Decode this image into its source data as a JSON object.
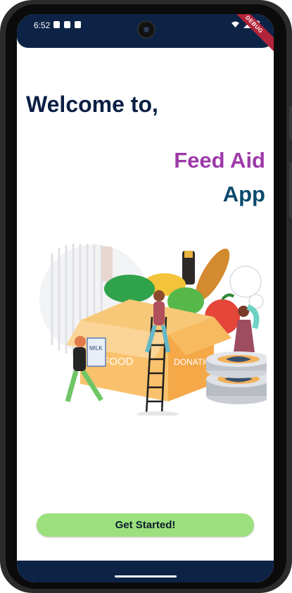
{
  "status_bar": {
    "time": "6:52",
    "debug_label": "DEBUG"
  },
  "welcome": {
    "greeting": "Welcome to,",
    "app_name": "Feed Aid",
    "app_word": "App"
  },
  "illustration": {
    "box_text_left": "FOOD",
    "box_text_right": "DONATION",
    "milk_label": "MILK"
  },
  "cta": {
    "label": "Get Started!"
  },
  "colors": {
    "status_bar": "#0d2346",
    "heading": "#0b1f44",
    "brand": "#9d3aa8",
    "app_word": "#0b4a6e",
    "button": "#9be07c"
  }
}
